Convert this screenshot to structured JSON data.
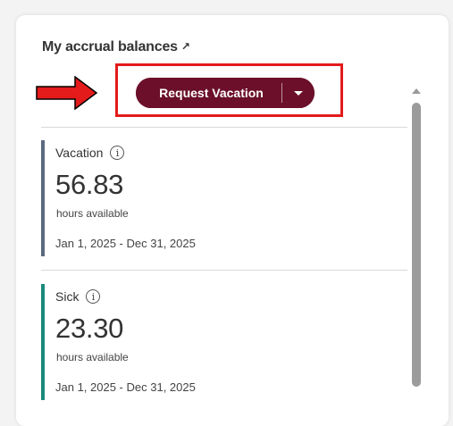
{
  "card": {
    "title": "My accrual balances",
    "title_link_icon": "arrow-up-right-icon"
  },
  "actions": {
    "request_label": "Request Vacation",
    "dropdown_icon": "caret-down-icon",
    "button_color": "#6b0f2a"
  },
  "annotation": {
    "highlight_color": "#e31b1b",
    "arrow_color": "#e31b1b"
  },
  "balances": [
    {
      "name": "Vacation",
      "amount": "56.83",
      "unit": "hours available",
      "period": "Jan 1, 2025 - Dec 31, 2025",
      "accent_color": "#5a6a80"
    },
    {
      "name": "Sick",
      "amount": "23.30",
      "unit": "hours available",
      "period": "Jan 1, 2025 - Dec 31, 2025",
      "accent_color": "#1a8a7a"
    }
  ]
}
